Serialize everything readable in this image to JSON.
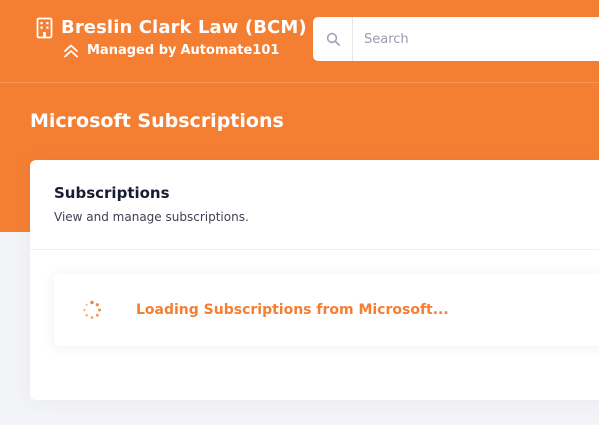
{
  "header": {
    "org_name": "Breslin Clark Law (BCM)",
    "managed_prefix": "Managed by",
    "managed_by": "Automate101",
    "org_icon": "building-icon",
    "managed_icon": "chevrons-up-icon"
  },
  "search": {
    "placeholder": "Search",
    "value": "",
    "icon": "search-icon"
  },
  "page": {
    "title": "Microsoft Subscriptions"
  },
  "card": {
    "title": "Subscriptions",
    "subtitle": "View and manage subscriptions.",
    "loading_text": "Loading Subscriptions from Microsoft...",
    "loading_icon": "spinner-icon"
  },
  "colors": {
    "brand": "#f47f33",
    "card_background": "#ffffff",
    "page_background": "#f3f4f7",
    "title_text": "#181c32"
  }
}
